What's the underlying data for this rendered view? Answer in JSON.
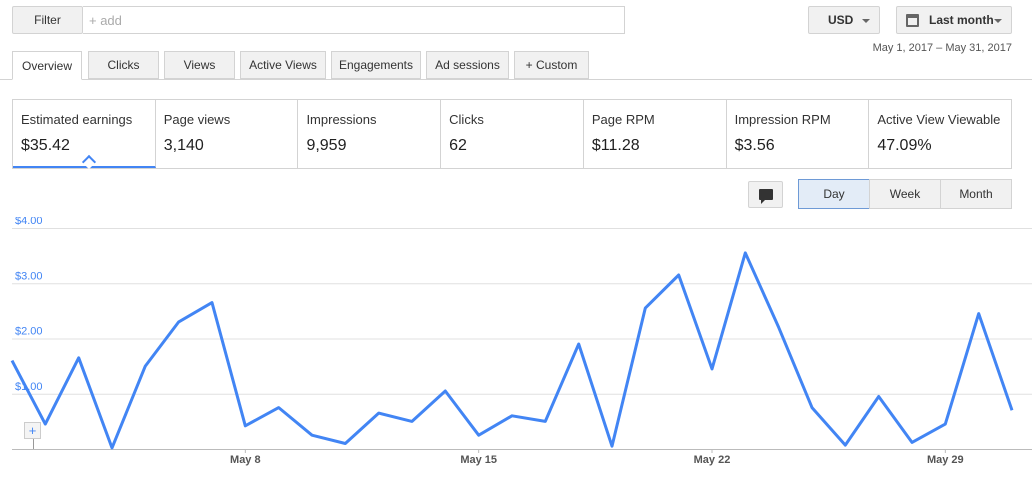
{
  "filter": {
    "label": "Filter",
    "placeholder": "+ add"
  },
  "currency": {
    "label": "USD"
  },
  "period": {
    "label": "Last month",
    "range": "May 1, 2017 – May 31, 2017"
  },
  "tabs": [
    {
      "label": "Overview"
    },
    {
      "label": "Clicks"
    },
    {
      "label": "Views"
    },
    {
      "label": "Active Views"
    },
    {
      "label": "Engagements"
    },
    {
      "label": "Ad sessions"
    },
    {
      "label": "+ Custom"
    }
  ],
  "metrics": [
    {
      "label": "Estimated earnings",
      "value": "$35.42"
    },
    {
      "label": "Page views",
      "value": "3,140"
    },
    {
      "label": "Impressions",
      "value": "9,959"
    },
    {
      "label": "Clicks",
      "value": "62"
    },
    {
      "label": "Page RPM",
      "value": "$11.28"
    },
    {
      "label": "Impression RPM",
      "value": "$3.56"
    },
    {
      "label": "Active View Viewable",
      "value": "47.09%"
    }
  ],
  "granularity": {
    "day": "Day",
    "week": "Week",
    "month": "Month"
  },
  "chart_data": {
    "type": "line",
    "ylim": [
      0,
      4
    ],
    "y_tick_labels": [
      "$1.00",
      "$2.00",
      "$3.00",
      "$4.00"
    ],
    "x_tick_labels": [
      {
        "day": 8,
        "label": "May 8"
      },
      {
        "day": 15,
        "label": "May 15"
      },
      {
        "day": 22,
        "label": "May 22"
      },
      {
        "day": 29,
        "label": "May 29"
      }
    ],
    "series": [
      {
        "color": "#4285f4",
        "x": [
          1,
          2,
          3,
          4,
          5,
          6,
          7,
          8,
          9,
          10,
          11,
          12,
          13,
          14,
          15,
          16,
          17,
          18,
          19,
          20,
          21,
          22,
          23,
          24,
          25,
          26,
          27,
          28,
          29,
          30,
          31
        ],
        "values": [
          1.6,
          0.45,
          1.65,
          0.02,
          1.5,
          2.3,
          2.65,
          0.42,
          0.75,
          0.25,
          0.1,
          0.65,
          0.5,
          1.05,
          0.25,
          0.6,
          0.5,
          1.9,
          0.05,
          2.55,
          3.15,
          1.45,
          3.55,
          2.2,
          0.75,
          0.07,
          0.95,
          0.12,
          0.45,
          2.45,
          0.7
        ]
      }
    ]
  }
}
